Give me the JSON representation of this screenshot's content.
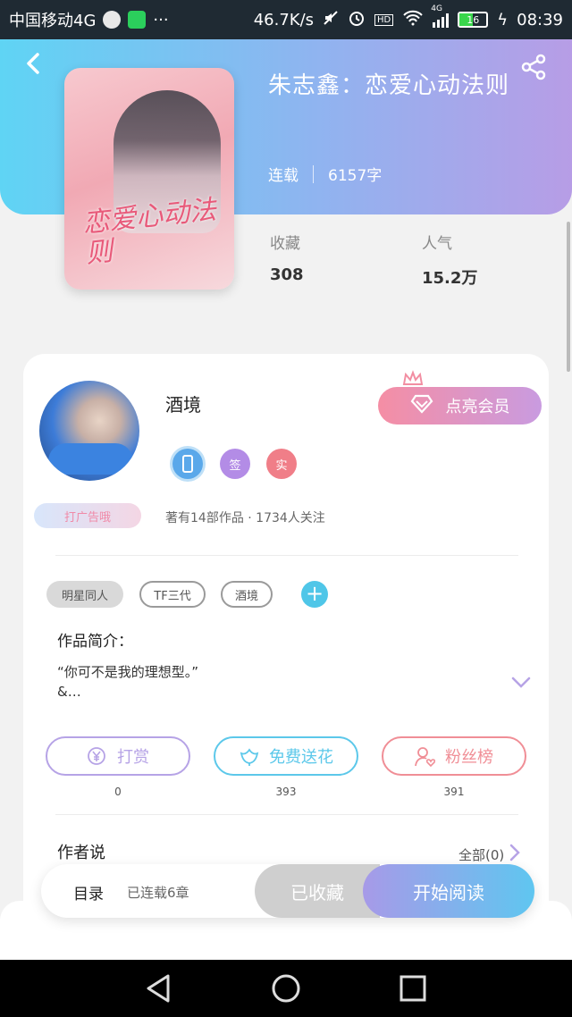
{
  "status_bar": {
    "carrier": "中国移动4G",
    "speed": "46.7K/s",
    "battery": "16",
    "network": "4G",
    "time": "08:39",
    "icons": [
      "cat-app-icon",
      "wechat-icon",
      "more-icon",
      "mute-icon",
      "alarm-icon",
      "hd-icon",
      "wifi-icon",
      "signal-icon",
      "battery-icon",
      "charging-icon"
    ]
  },
  "header": {
    "back_icon": "back-arrow-icon",
    "share_icon": "share-icon"
  },
  "book": {
    "title": "朱志鑫：恋爱心动法则",
    "cover_text": "恋爱心动法则",
    "status": "连载",
    "word_count": "6157字"
  },
  "stats": {
    "favorites_label": "收藏",
    "favorites_value": "308",
    "popularity_label": "人气",
    "popularity_value": "15.2万"
  },
  "author": {
    "name": "酒境",
    "vip_button": "点亮会员",
    "badges": [
      {
        "icon": "phone-badge-icon",
        "label": "",
        "color": "#5aa8ea"
      },
      {
        "icon": "sign-badge-icon",
        "label": "签",
        "color": "#b38ce6"
      },
      {
        "icon": "real-badge-icon",
        "label": "实",
        "color": "#f07e88"
      }
    ],
    "ad_tag": "打广告哦",
    "info": "著有14部作品 · 1734人关注"
  },
  "tags": [
    "明星同人",
    "TF三代",
    "酒境"
  ],
  "intro": {
    "title": "作品简介：",
    "line1": "“你可不是我的理想型。”",
    "line2": "&…"
  },
  "actions": [
    {
      "label": "打赏",
      "count": "0",
      "color": "#b6a3e6",
      "icon": "yen-icon"
    },
    {
      "label": "免费送花",
      "count": "393",
      "color": "#5cc8ea",
      "icon": "flower-icon"
    },
    {
      "label": "粉丝榜",
      "count": "391",
      "color": "#f08e96",
      "icon": "fan-heart-icon"
    }
  ],
  "author_say": {
    "title": "作者说",
    "all_link": "全部(0)"
  },
  "bottom_bar": {
    "toc": "目录",
    "chapters": "已连载6章",
    "collected": "已收藏",
    "read": "开始阅读"
  },
  "colors": {
    "header_start": "#5fd4f4",
    "header_end": "#b79de6",
    "accent_pink": "#f58ea4",
    "accent_cyan": "#4fc6e8"
  }
}
